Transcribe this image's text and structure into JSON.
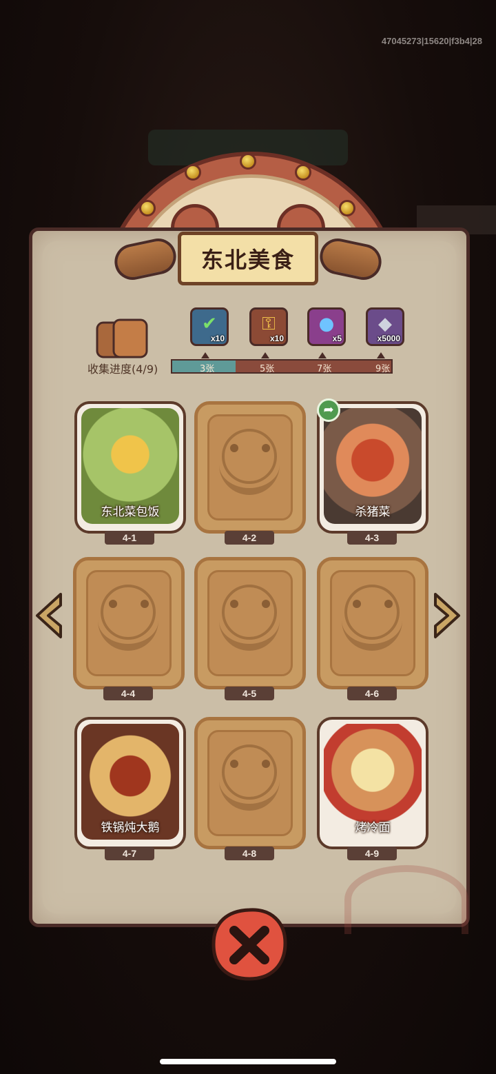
{
  "debug": {
    "id_text": "47045273|15620|f3b4|28"
  },
  "panel": {
    "title": "东北美食"
  },
  "collection": {
    "label": "收集进度(4/9)",
    "collected": 4,
    "total": 9,
    "progress_fraction": 0.29,
    "milestones": [
      {
        "label": "3张",
        "reward_icon": "treasure-chest-check-icon",
        "count": "x10"
      },
      {
        "label": "5张",
        "reward_icon": "gold-key-icon",
        "count": "x10"
      },
      {
        "label": "7张",
        "reward_icon": "purple-orb-icon",
        "count": "x5"
      },
      {
        "label": "9张",
        "reward_icon": "silver-crystal-icon",
        "count": "x5000"
      }
    ]
  },
  "cards": [
    {
      "num": "4-1",
      "name": "东北菜包饭",
      "unlocked": true
    },
    {
      "num": "4-2",
      "name": "",
      "unlocked": false
    },
    {
      "num": "4-3",
      "name": "杀猪菜",
      "unlocked": true
    },
    {
      "num": "4-4",
      "name": "",
      "unlocked": false
    },
    {
      "num": "4-5",
      "name": "",
      "unlocked": false
    },
    {
      "num": "4-6",
      "name": "",
      "unlocked": false
    },
    {
      "num": "4-7",
      "name": "铁锅炖大鹅",
      "unlocked": true
    },
    {
      "num": "4-8",
      "name": "",
      "unlocked": false
    },
    {
      "num": "4-9",
      "name": "烤冷面",
      "unlocked": true
    }
  ],
  "colors": {
    "parchment": "#cfc2ac",
    "progress_fill": "#5f9a98",
    "progress_track": "#8a4b3c",
    "close_button": "#e0523f",
    "share_button": "#4f9a4f"
  }
}
